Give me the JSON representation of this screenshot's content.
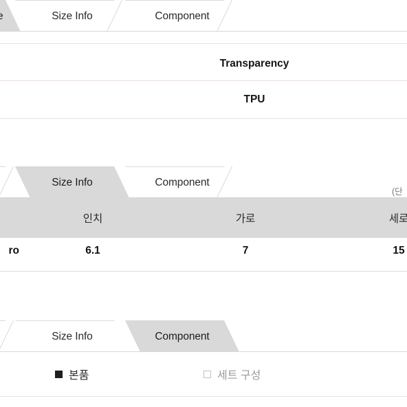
{
  "page": {
    "language": "ko-KR",
    "background": "#ffffff",
    "selected_tab_color": "#d9d9d9",
    "table_header_color": "#d9d9d9",
    "pink_rule_color": "#e8dfe2",
    "grey_rule_color": "#e3e3e3"
  },
  "sections": [
    {
      "id": "detail-section",
      "tabs": [
        {
          "label": "e",
          "selected": true,
          "clipped": true
        },
        {
          "label": "Size Info",
          "selected": false,
          "clipped": false
        },
        {
          "label": "Component",
          "selected": false,
          "clipped": false
        }
      ],
      "rows": [
        {
          "label": "Transparency"
        },
        {
          "label": "TPU"
        }
      ]
    },
    {
      "id": "size-info-section",
      "tabs": [
        {
          "label": "",
          "selected": false,
          "clipped": true
        },
        {
          "label": "Size Info",
          "selected": true,
          "clipped": false
        },
        {
          "label": "Component",
          "selected": false,
          "clipped": false
        }
      ],
      "unit_note": "(단",
      "table": {
        "headers": [
          "인치",
          "가로",
          "세로"
        ],
        "rows": [
          {
            "model": "ro",
            "values": [
              "6.1",
              "7",
              "15"
            ]
          }
        ]
      }
    },
    {
      "id": "component-section",
      "tabs": [
        {
          "label": "",
          "selected": false,
          "clipped": true
        },
        {
          "label": "Size Info",
          "selected": false,
          "clipped": false
        },
        {
          "label": "Component",
          "selected": true,
          "clipped": false
        }
      ],
      "options": [
        {
          "label": "본품",
          "checked": true
        },
        {
          "label": "세트 구성",
          "checked": false
        }
      ]
    }
  ]
}
